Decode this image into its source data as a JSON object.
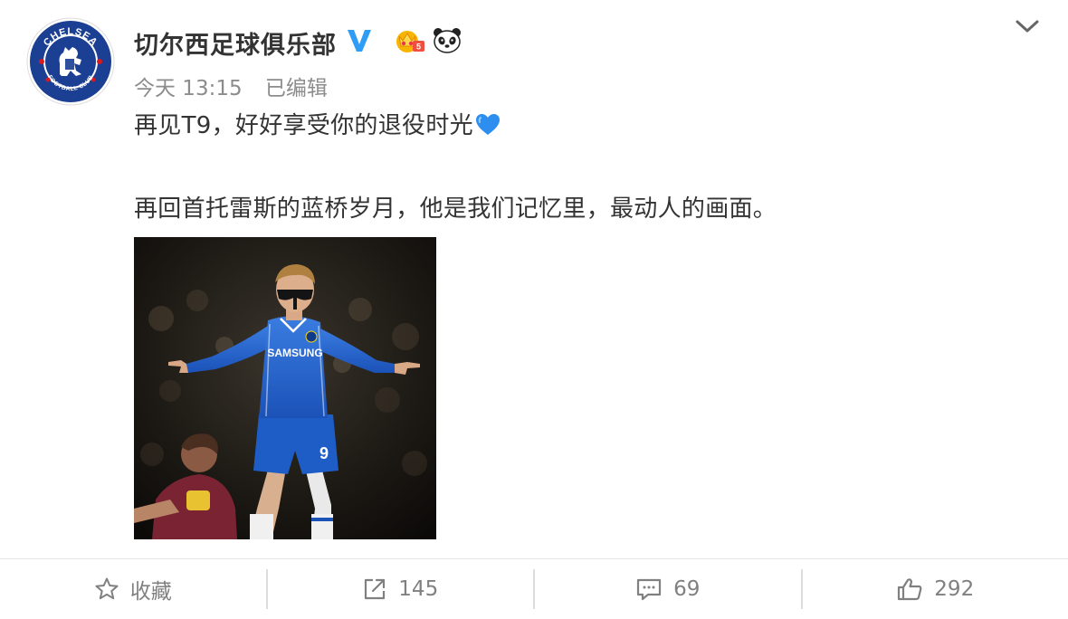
{
  "post": {
    "author": {
      "name": "切尔西足球俱乐部",
      "avatar_icon": "chelsea-crest-icon",
      "avatar_text_top": "CHELSEA",
      "avatar_text_bottom": "FOOTBALL CLUB",
      "badges": [
        "verified-v-icon",
        "crown-level-badge-icon",
        "panda-emoji-icon"
      ]
    },
    "time": "今天 13:15",
    "edited_label": "已编辑",
    "text_line1": "再见T9，好好享受你的退役时光",
    "text_line1_emoji": "blue-heart-icon",
    "text_line2": "再回首托雷斯的蓝桥岁月，他是我们记忆里，最动人的画面。",
    "image": {
      "description_icon": "player-celebration-photo",
      "shirt_text": "SAMSUNG",
      "shirt_number": "9"
    }
  },
  "actions": {
    "favorite_label": "收藏",
    "repost_count": "145",
    "comment_count": "69",
    "like_count": "292"
  },
  "colors": {
    "text": "#333333",
    "meta": "#8c8c8c",
    "verified_blue": "#2f9df5",
    "chelsea_blue": "#034694",
    "action_gray": "#808080"
  }
}
